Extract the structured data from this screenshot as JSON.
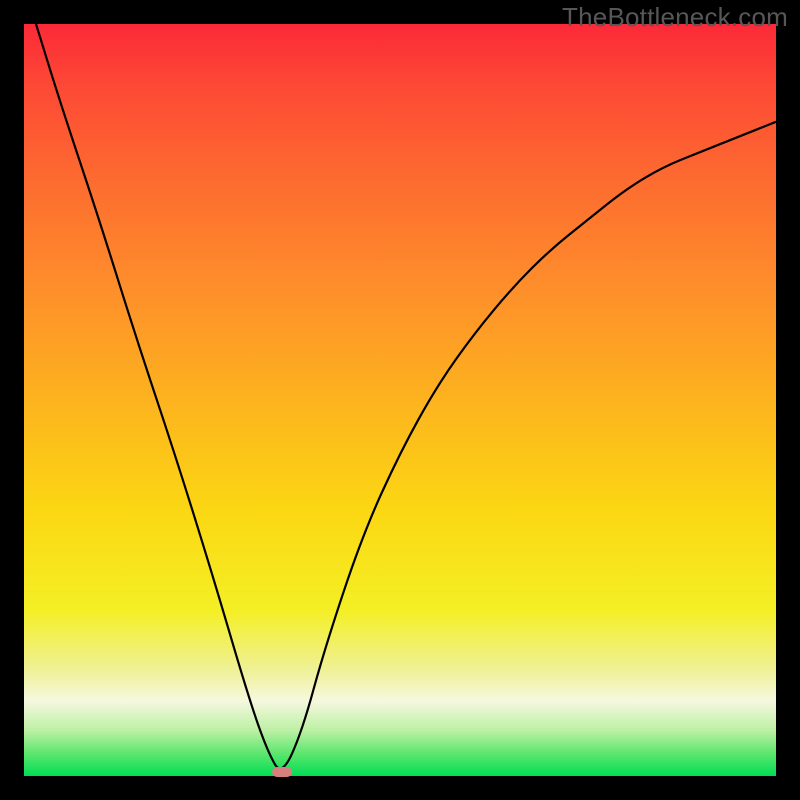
{
  "watermark": "TheBottleneck.com",
  "colors": {
    "frame": "#000000",
    "curve": "#000000",
    "marker": "#d77f7e",
    "gradient_top": "#fc2938",
    "gradient_bottom": "#00de54"
  },
  "chart_data": {
    "type": "line",
    "title": "",
    "xlabel": "",
    "ylabel": "",
    "xlim": [
      0,
      1
    ],
    "ylim": [
      0,
      1
    ],
    "notes": "V-shaped bottleneck curve on a vertical red→green gradient. Y encodes bottleneck severity (top = bad/red, bottom = good/green). Left branch descends steeply from the top-left corner to a minimum; right branch rises with decreasing slope toward the upper-right. Marker indicates the optimum (zero-bottleneck) point.",
    "minimum": {
      "x": 0.343,
      "y": 0.0
    },
    "series": [
      {
        "name": "bottleneck-curve",
        "x": [
          0.016,
          0.05,
          0.1,
          0.15,
          0.2,
          0.25,
          0.3,
          0.325,
          0.343,
          0.37,
          0.4,
          0.45,
          0.5,
          0.55,
          0.6,
          0.65,
          0.7,
          0.75,
          0.8,
          0.85,
          0.9,
          0.95,
          1.0
        ],
        "y": [
          1.0,
          0.89,
          0.74,
          0.58,
          0.43,
          0.27,
          0.1,
          0.03,
          0.0,
          0.06,
          0.17,
          0.32,
          0.43,
          0.52,
          0.59,
          0.65,
          0.7,
          0.74,
          0.78,
          0.81,
          0.83,
          0.85,
          0.87
        ]
      }
    ]
  }
}
